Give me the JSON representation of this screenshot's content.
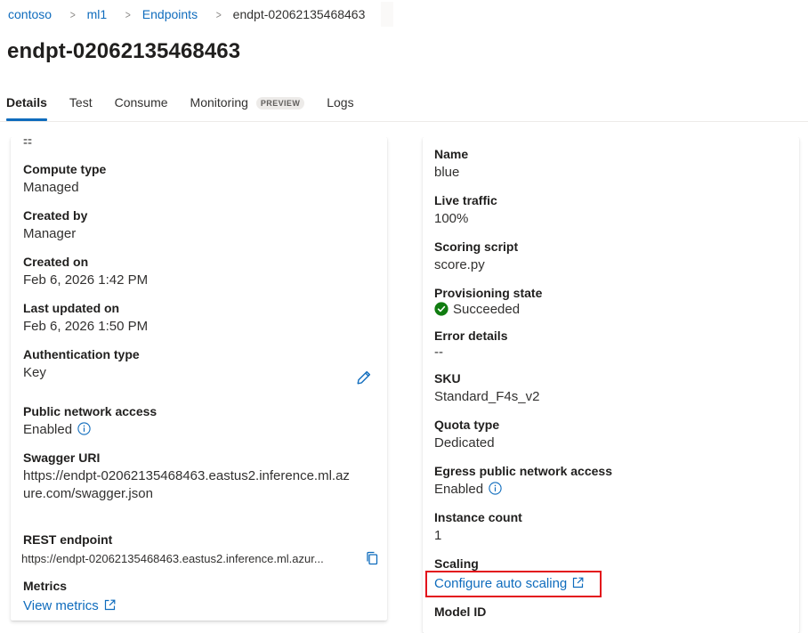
{
  "breadcrumb": {
    "items": [
      "contoso",
      "ml1",
      "Endpoints"
    ],
    "current": "endpt-02062135468463"
  },
  "page_title": "endpt-02062135468463",
  "tabs": [
    {
      "label": "Details",
      "active": true
    },
    {
      "label": "Test"
    },
    {
      "label": "Consume"
    },
    {
      "label": "Monitoring",
      "badge": "PREVIEW"
    },
    {
      "label": "Logs"
    }
  ],
  "left_card": {
    "top_value": "--",
    "compute_type": {
      "label": "Compute type",
      "value": "Managed"
    },
    "created_by": {
      "label": "Created by",
      "value": "Manager"
    },
    "created_on": {
      "label": "Created on",
      "value": "Feb 6, 2026 1:42 PM"
    },
    "last_updated_on": {
      "label": "Last updated on",
      "value": "Feb 6, 2026 1:50 PM"
    },
    "authentication_type": {
      "label": "Authentication type",
      "value": "Key",
      "edit_icon": "pencil-icon"
    },
    "public_network_access": {
      "label": "Public network access",
      "value": "Enabled",
      "icon": "info-icon"
    },
    "swagger_uri": {
      "label": "Swagger URI",
      "value": "https://endpt-02062135468463.eastus2.inference.ml.azure.com/swagger.json"
    },
    "rest_endpoint": {
      "label": "REST endpoint",
      "value": "https://endpt-02062135468463.eastus2.inference.ml.azur...",
      "copy_icon": "copy-icon"
    },
    "metrics": {
      "label": "Metrics",
      "link": "View metrics",
      "icon": "external-link-icon"
    }
  },
  "right_card": {
    "name": {
      "label": "Name",
      "value": "blue"
    },
    "live_traffic": {
      "label": "Live traffic",
      "value": "100%"
    },
    "scoring_script": {
      "label": "Scoring script",
      "value": "score.py"
    },
    "provisioning_state": {
      "label": "Provisioning state",
      "value": "Succeeded",
      "icon": "success-check-icon"
    },
    "error_details": {
      "label": "Error details",
      "value": "--"
    },
    "sku": {
      "label": "SKU",
      "value": "Standard_F4s_v2"
    },
    "quota_type": {
      "label": "Quota type",
      "value": "Dedicated"
    },
    "egress_public_network_access": {
      "label": "Egress public network access",
      "value": "Enabled",
      "icon": "info-icon"
    },
    "instance_count": {
      "label": "Instance count",
      "value": "1"
    },
    "scaling": {
      "label": "Scaling",
      "link": "Configure auto scaling",
      "icon": "external-link-icon"
    },
    "model_id": {
      "label": "Model ID"
    }
  },
  "colors": {
    "link": "#0f6cbd",
    "tab_active_underline": "#0f6cbd",
    "success": "#107c10",
    "highlight": "#e3121b"
  }
}
